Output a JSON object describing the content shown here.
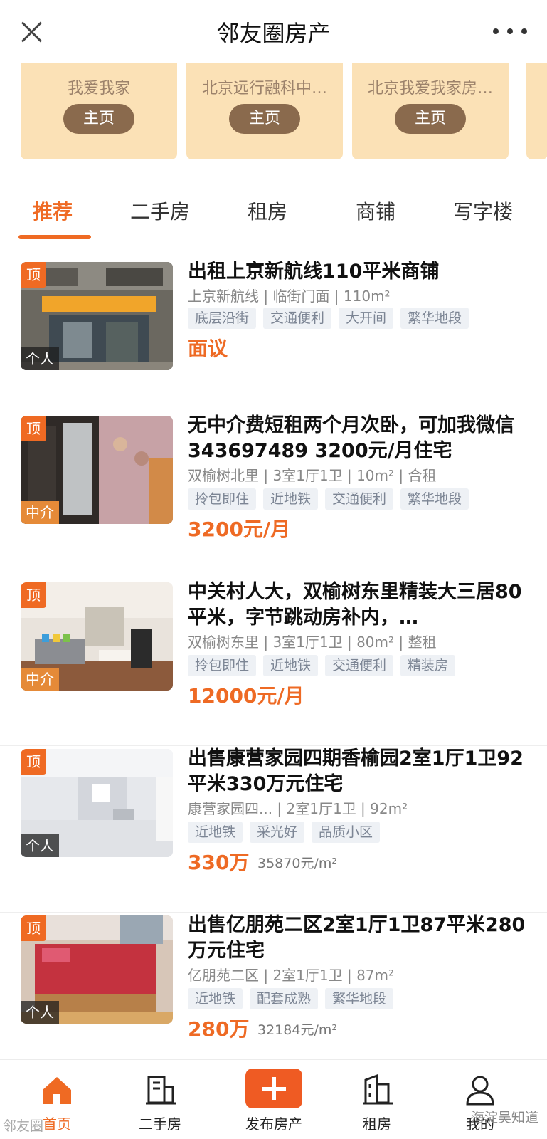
{
  "header": {
    "title": "邻友圈房产"
  },
  "agents": [
    {
      "name": "我爱我家",
      "button": "主页"
    },
    {
      "name": "北京远行融科中…",
      "button": "主页"
    },
    {
      "name": "北京我爱我家房…",
      "button": "主页"
    }
  ],
  "tabs": [
    {
      "label": "推荐",
      "active": true
    },
    {
      "label": "二手房",
      "active": false
    },
    {
      "label": "租房",
      "active": false
    },
    {
      "label": "商铺",
      "active": false
    },
    {
      "label": "写字楼",
      "active": false
    }
  ],
  "listings": [
    {
      "top_badge": "顶",
      "source": "个人",
      "title": "出租上京新航线110平米商铺",
      "meta": "上京新航线 | 临街门面 | 110m²",
      "tags": [
        "底层沿街",
        "交通便利",
        "大开间",
        "繁华地段"
      ],
      "price": "面议",
      "unit_price": ""
    },
    {
      "top_badge": "顶",
      "source": "中介",
      "title": "无中介费短租两个月次卧，可加我微信343697489 3200元/月住宅",
      "meta": "双榆树北里 | 3室1厅1卫 | 10m² | 合租",
      "tags": [
        "拎包即住",
        "近地铁",
        "交通便利",
        "繁华地段"
      ],
      "price": "3200元/月",
      "unit_price": ""
    },
    {
      "top_badge": "顶",
      "source": "中介",
      "title": "中关村人大，双榆树东里精装大三居80平米，字节跳动房补内，…",
      "meta": "双榆树东里 | 3室1厅1卫 | 80m² | 整租",
      "tags": [
        "拎包即住",
        "近地铁",
        "交通便利",
        "精装房"
      ],
      "price": "12000元/月",
      "unit_price": ""
    },
    {
      "top_badge": "顶",
      "source": "个人",
      "title": "出售康营家园四期香榆园2室1厅1卫92平米330万元住宅",
      "meta": "康营家园四... | 2室1厅1卫 | 92m²",
      "tags": [
        "近地铁",
        "采光好",
        "品质小区"
      ],
      "price": "330万",
      "unit_price": "35870元/m²"
    },
    {
      "top_badge": "顶",
      "source": "个人",
      "title": "出售亿朋苑二区2室1厅1卫87平米280万元住宅",
      "meta": "亿朋苑二区 | 2室1厅1卫 | 87m²",
      "tags": [
        "近地铁",
        "配套成熟",
        "繁华地段"
      ],
      "price": "280万",
      "unit_price": "32184元/m²"
    }
  ],
  "bottom_nav": [
    {
      "label": "首页",
      "icon": "home-icon",
      "active": true
    },
    {
      "label": "二手房",
      "icon": "building-icon",
      "active": false
    },
    {
      "label": "发布房产",
      "icon": "plus-icon",
      "active": false
    },
    {
      "label": "租房",
      "icon": "apartment-icon",
      "active": false
    },
    {
      "label": "我的",
      "icon": "user-icon",
      "active": false
    }
  ],
  "watermarks": {
    "left": "邻友圈",
    "right": "海淀吴知道"
  },
  "colors": {
    "accent": "#ef6a23",
    "card_bg": "#fbe1b6",
    "card_button": "#8a6a4d"
  }
}
